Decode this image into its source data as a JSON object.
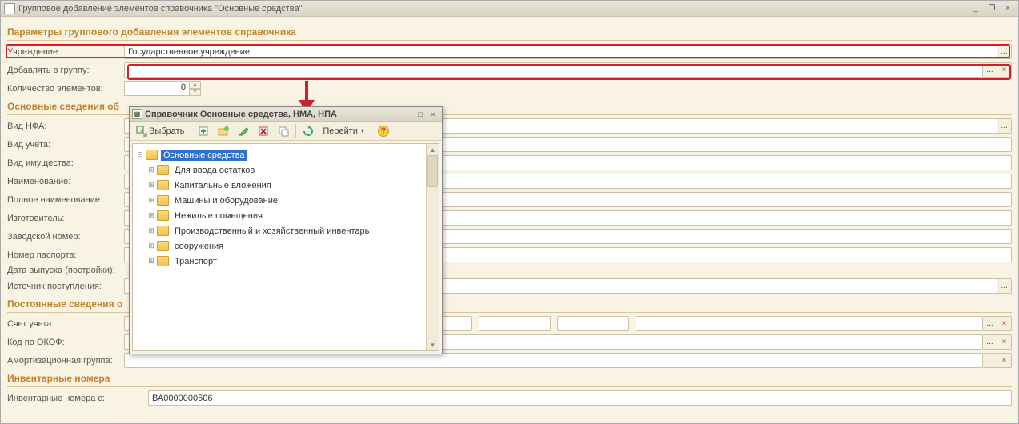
{
  "window": {
    "title": "Групповое добавление элементов справочника \"Основные средства\"",
    "btn_min": "_",
    "btn_restore": "❐",
    "btn_close": "×"
  },
  "sections": {
    "params": "Параметры группового добавления элементов справочника",
    "main_info": "Основные сведения об",
    "perm_info": "Постоянные сведения о",
    "inv_numbers": "Инвентарные номера"
  },
  "labels": {
    "inst": "Учреждение:",
    "group": "Добавлять в группу:",
    "count": "Количество элементов:",
    "nfa": "Вид НФА:",
    "acct": "Вид учета:",
    "prop": "Вид имущества:",
    "name": "Наименование:",
    "fullname": "Полное наименование:",
    "maker": "Изготовитель:",
    "serial": "Заводской номер:",
    "passport": "Номер паспорта:",
    "date": "Дата выпуска (постройки):",
    "source": "Источник поступления:",
    "account": "Счет учета:",
    "okof": "Код по ОКОФ:",
    "amort": "Амортизационная группа:",
    "inv_from": "Инвентарные номера с:"
  },
  "values": {
    "inst": "Государственное учреждение",
    "group": "",
    "count": "0",
    "inv_from": "ВА0000000506"
  },
  "field_btn": {
    "dots": "...",
    "x": "×"
  },
  "popup": {
    "title": "Справочник Основные средства, НМА, НПА",
    "btn_min": "_",
    "btn_max": "□",
    "btn_close": "×",
    "toolbar": {
      "select": "Выбрать",
      "go": "Перейти",
      "arrow": "▾",
      "help": "?"
    },
    "tree": {
      "root": "Основные средства",
      "children": [
        "Для ввода остатков",
        "Капитальные вложения",
        "Машины и оборудование",
        "Нежилые помещения",
        "Производственный и хозяйственный инвентарь",
        "сооружения",
        "Транспорт"
      ]
    }
  }
}
